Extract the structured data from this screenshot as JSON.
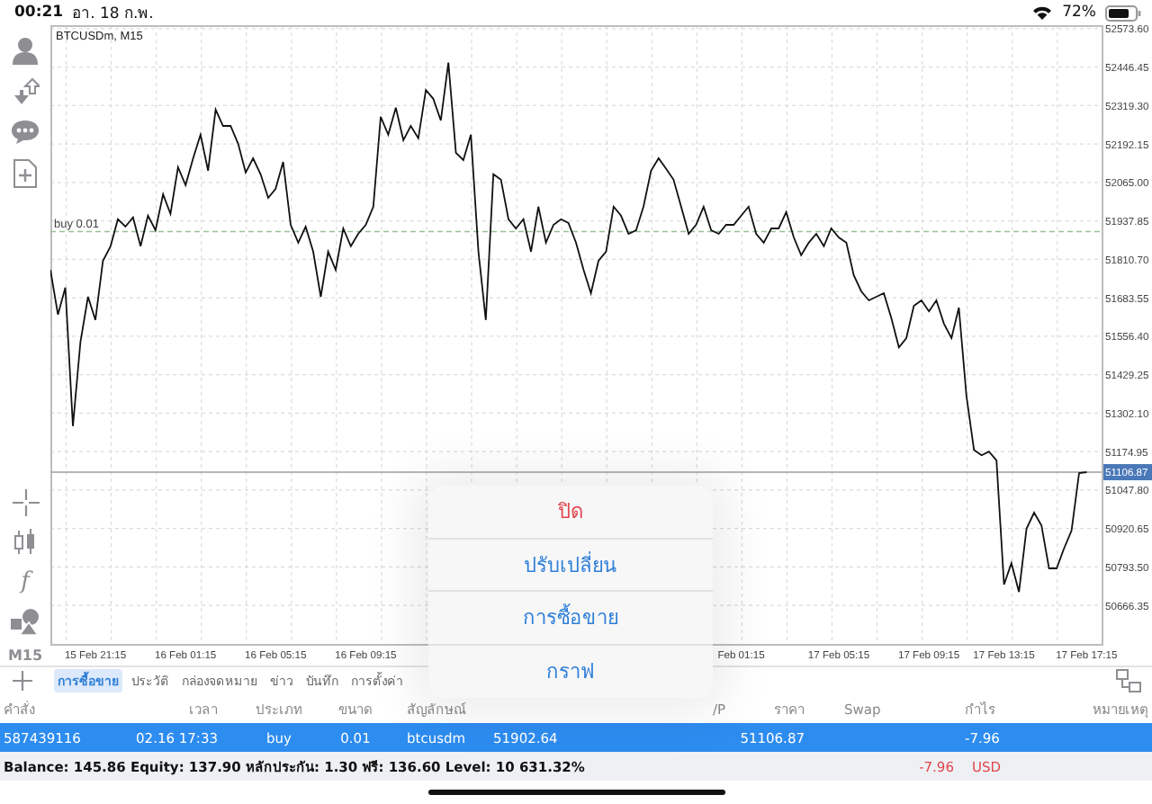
{
  "status_bar": {
    "time": "00:21",
    "date": "อา. 18 ก.พ.",
    "battery": "72%"
  },
  "left_toolbar": {
    "function_glyph": "f",
    "timeframe": "M15"
  },
  "chart": {
    "title": "BTCUSDm, M15",
    "chart_data": {
      "type": "line",
      "grid": true,
      "categories": [
        null,
        null,
        null,
        null,
        null,
        null,
        "15 Feb 21:15",
        null,
        null,
        null,
        null,
        null,
        null,
        null,
        null,
        null,
        null,
        null,
        "16 Feb 01:15",
        null,
        null,
        null,
        null,
        null,
        null,
        null,
        null,
        null,
        null,
        null,
        "16 Feb 05:15",
        null,
        null,
        null,
        null,
        null,
        null,
        null,
        null,
        null,
        null,
        null,
        "16 Feb 09:15",
        null,
        null,
        null,
        null,
        null,
        null,
        null,
        null,
        null,
        null,
        null,
        null,
        null,
        null,
        null,
        null,
        null,
        null,
        null,
        null,
        null,
        null,
        null,
        null,
        null,
        null,
        null,
        null,
        null,
        null,
        null,
        null,
        null,
        null,
        null,
        null,
        null,
        null,
        null,
        null,
        null,
        null,
        null,
        null,
        null,
        null,
        null,
        null,
        null,
        "Feb 01:15",
        null,
        null,
        null,
        null,
        null,
        null,
        null,
        null,
        null,
        null,
        null,
        null,
        "17 Feb 05:15",
        null,
        null,
        null,
        null,
        null,
        null,
        null,
        null,
        null,
        null,
        null,
        "17 Feb 09:15",
        null,
        null,
        null,
        null,
        null,
        null,
        null,
        null,
        null,
        "17 Feb 13:15",
        null,
        null,
        null,
        null,
        null,
        null,
        null,
        null,
        null,
        null,
        "17 Feb 17:15"
      ],
      "series": [
        {
          "color": "#111111",
          "values": [
            51776,
            51628,
            51717,
            51259,
            51538,
            51687,
            51610,
            51806,
            51854,
            51943,
            51919,
            51949,
            51854,
            51955,
            51907,
            52026,
            51961,
            52115,
            52056,
            52145,
            52223,
            52104,
            52306,
            52252,
            52252,
            52193,
            52098,
            52145,
            52092,
            52014,
            52044,
            52133,
            51925,
            51866,
            51919,
            51836,
            51687,
            51836,
            51776,
            51913,
            51854,
            51895,
            51925,
            51985,
            52282,
            52223,
            52312,
            52205,
            52252,
            52211,
            52371,
            52342,
            52270,
            52461,
            52163,
            52139,
            52223,
            51836,
            51610,
            52092,
            52074,
            51943,
            51913,
            51943,
            51836,
            51985,
            51866,
            51925,
            51943,
            51931,
            51866,
            51776,
            51699,
            51806,
            51836,
            51985,
            51955,
            51895,
            51907,
            51985,
            52104,
            52145,
            52110,
            52074,
            51985,
            51895,
            51925,
            51985,
            51907,
            51895,
            51925,
            51925,
            51955,
            51985,
            51895,
            51866,
            51913,
            51913,
            51967,
            51883,
            51824,
            51866,
            51895,
            51854,
            51913,
            51883,
            51866,
            51758,
            51705,
            51675,
            51687,
            51699,
            51616,
            51520,
            51550,
            51657,
            51675,
            51639,
            51675,
            51598,
            51550,
            51651,
            51360,
            51181,
            51163,
            51175,
            51146,
            50735,
            50806,
            50711,
            50920,
            50973,
            50931,
            50789,
            50789,
            50854,
            50914,
            51104,
            51107
          ]
        }
      ],
      "ylim": [
        50539,
        52585
      ],
      "yticks": [
        {
          "value": 52573.6,
          "label": "52573.60"
        },
        {
          "value": 52446.45,
          "label": "52446.45"
        },
        {
          "value": 52319.3,
          "label": "52319.30"
        },
        {
          "value": 52192.15,
          "label": "52192.15"
        },
        {
          "value": 52065,
          "label": "52065.00"
        },
        {
          "value": 51937.85,
          "label": "51937.85"
        },
        {
          "value": 51810.7,
          "label": "51810.70"
        },
        {
          "value": 51683.55,
          "label": "51683.55"
        },
        {
          "value": 51556.4,
          "label": "51556.40"
        },
        {
          "value": 51429.25,
          "label": "51429.25"
        },
        {
          "value": 51302.1,
          "label": "51302.10"
        },
        {
          "value": 51174.95,
          "label": "51174.95"
        },
        {
          "value": 51047.8,
          "label": "51047.80"
        },
        {
          "value": 50920.65,
          "label": "50920.65"
        },
        {
          "value": 50793.5,
          "label": "50793.50"
        },
        {
          "value": 50666.35,
          "label": "50666.35"
        }
      ],
      "ref_lines": [
        {
          "axis": "y",
          "value": 51902.64,
          "label": "buy 0.01",
          "color": "#9bbf9b"
        },
        {
          "axis": "y",
          "value": 51106.87,
          "label": "51106.87",
          "color": "#9aa0a8"
        }
      ]
    }
  },
  "tabs": [
    {
      "label": "การซื้อขาย",
      "selected": true
    },
    {
      "label": "ประวัติ",
      "selected": false
    },
    {
      "label": "กล่องจดหมาย",
      "selected": false
    },
    {
      "label": "ข่าว",
      "selected": false
    },
    {
      "label": "บันทึก",
      "selected": false
    },
    {
      "label": "การตั้งค่า",
      "selected": false
    }
  ],
  "table": {
    "columns": [
      "คำสั่ง",
      "เวลา",
      "ประเภท",
      "ขนาด",
      "สัญลักษณ์",
      null,
      null,
      "/P",
      "ราคา",
      "Swap",
      "กำไร",
      "หมายเหตุ"
    ],
    "rows": [
      {
        "selected": true,
        "cells": [
          "587439116",
          "02.16 17:33",
          "buy",
          "0.01",
          "btcusdm",
          "51902.64",
          null,
          null,
          "51106.87",
          null,
          "-7.96",
          null
        ]
      }
    ]
  },
  "summary": {
    "text": "Balance: 145.86 Equity: 137.90 หลักประกัน: 1.30 ฟรี: 136.60 Level: 10 631.32%",
    "profit": "-7.96",
    "currency": "USD"
  },
  "popup_menu": {
    "items": [
      {
        "label": "ปิด",
        "kind": "destructive"
      },
      {
        "label": "ปรับเปลี่ยน",
        "kind": "action"
      },
      {
        "label": "การซื้อขาย",
        "kind": "action"
      },
      {
        "label": "กราฟ",
        "kind": "action"
      }
    ]
  }
}
